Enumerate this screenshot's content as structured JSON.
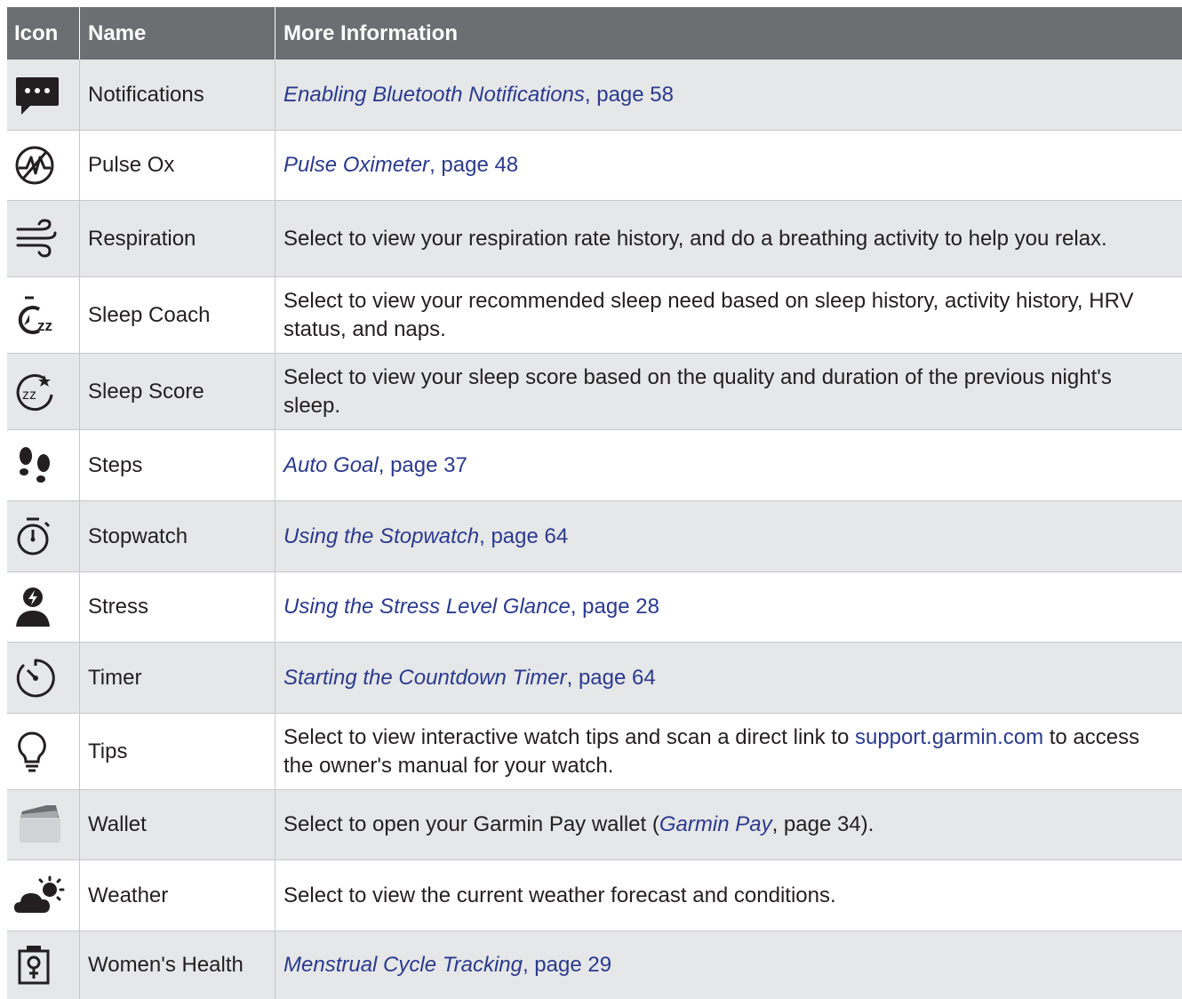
{
  "header": {
    "icon": "Icon",
    "name": "Name",
    "info": "More Information"
  },
  "rows": [
    {
      "icon": "notifications-icon",
      "name": "Notifications",
      "link": "Enabling Bluetooth Notifications",
      "suffix": ", page 58"
    },
    {
      "icon": "pulse-ox-icon",
      "name": "Pulse Ox",
      "link": "Pulse Oximeter",
      "suffix": ", page 48"
    },
    {
      "icon": "respiration-icon",
      "name": "Respiration",
      "text": "Select to view your respiration rate history, and do a breathing activity to help you relax."
    },
    {
      "icon": "sleep-coach-icon",
      "name": "Sleep Coach",
      "text": "Select to view your recommended sleep need based on sleep history, activity history, HRV status, and naps."
    },
    {
      "icon": "sleep-score-icon",
      "name": "Sleep Score",
      "text": "Select to view your sleep score based on the quality and duration of the previous night's sleep."
    },
    {
      "icon": "steps-icon",
      "name": "Steps",
      "link": "Auto Goal",
      "suffix": ", page 37"
    },
    {
      "icon": "stopwatch-icon",
      "name": "Stopwatch",
      "link": "Using the Stopwatch",
      "suffix": ", page 64"
    },
    {
      "icon": "stress-icon",
      "name": "Stress",
      "link": "Using the Stress Level Glance",
      "suffix": ", page 28"
    },
    {
      "icon": "timer-icon",
      "name": "Timer",
      "link": "Starting the Countdown Timer",
      "suffix": ", page 64"
    },
    {
      "icon": "tips-icon",
      "name": "Tips",
      "text_a": "Select to view interactive watch tips and scan a direct link to ",
      "url": "support.garmin.com",
      "text_b": " to access the owner's manual for your watch."
    },
    {
      "icon": "wallet-icon",
      "name": "Wallet",
      "text_a": "Select to open your Garmin Pay wallet (",
      "link": "Garmin Pay",
      "text_b": ", page 34)."
    },
    {
      "icon": "weather-icon",
      "name": "Weather",
      "text": "Select to view the current weather forecast and conditions."
    },
    {
      "icon": "womens-health-icon",
      "name": "Women's Health",
      "link": "Menstrual Cycle Tracking",
      "suffix": ", page 29"
    }
  ]
}
